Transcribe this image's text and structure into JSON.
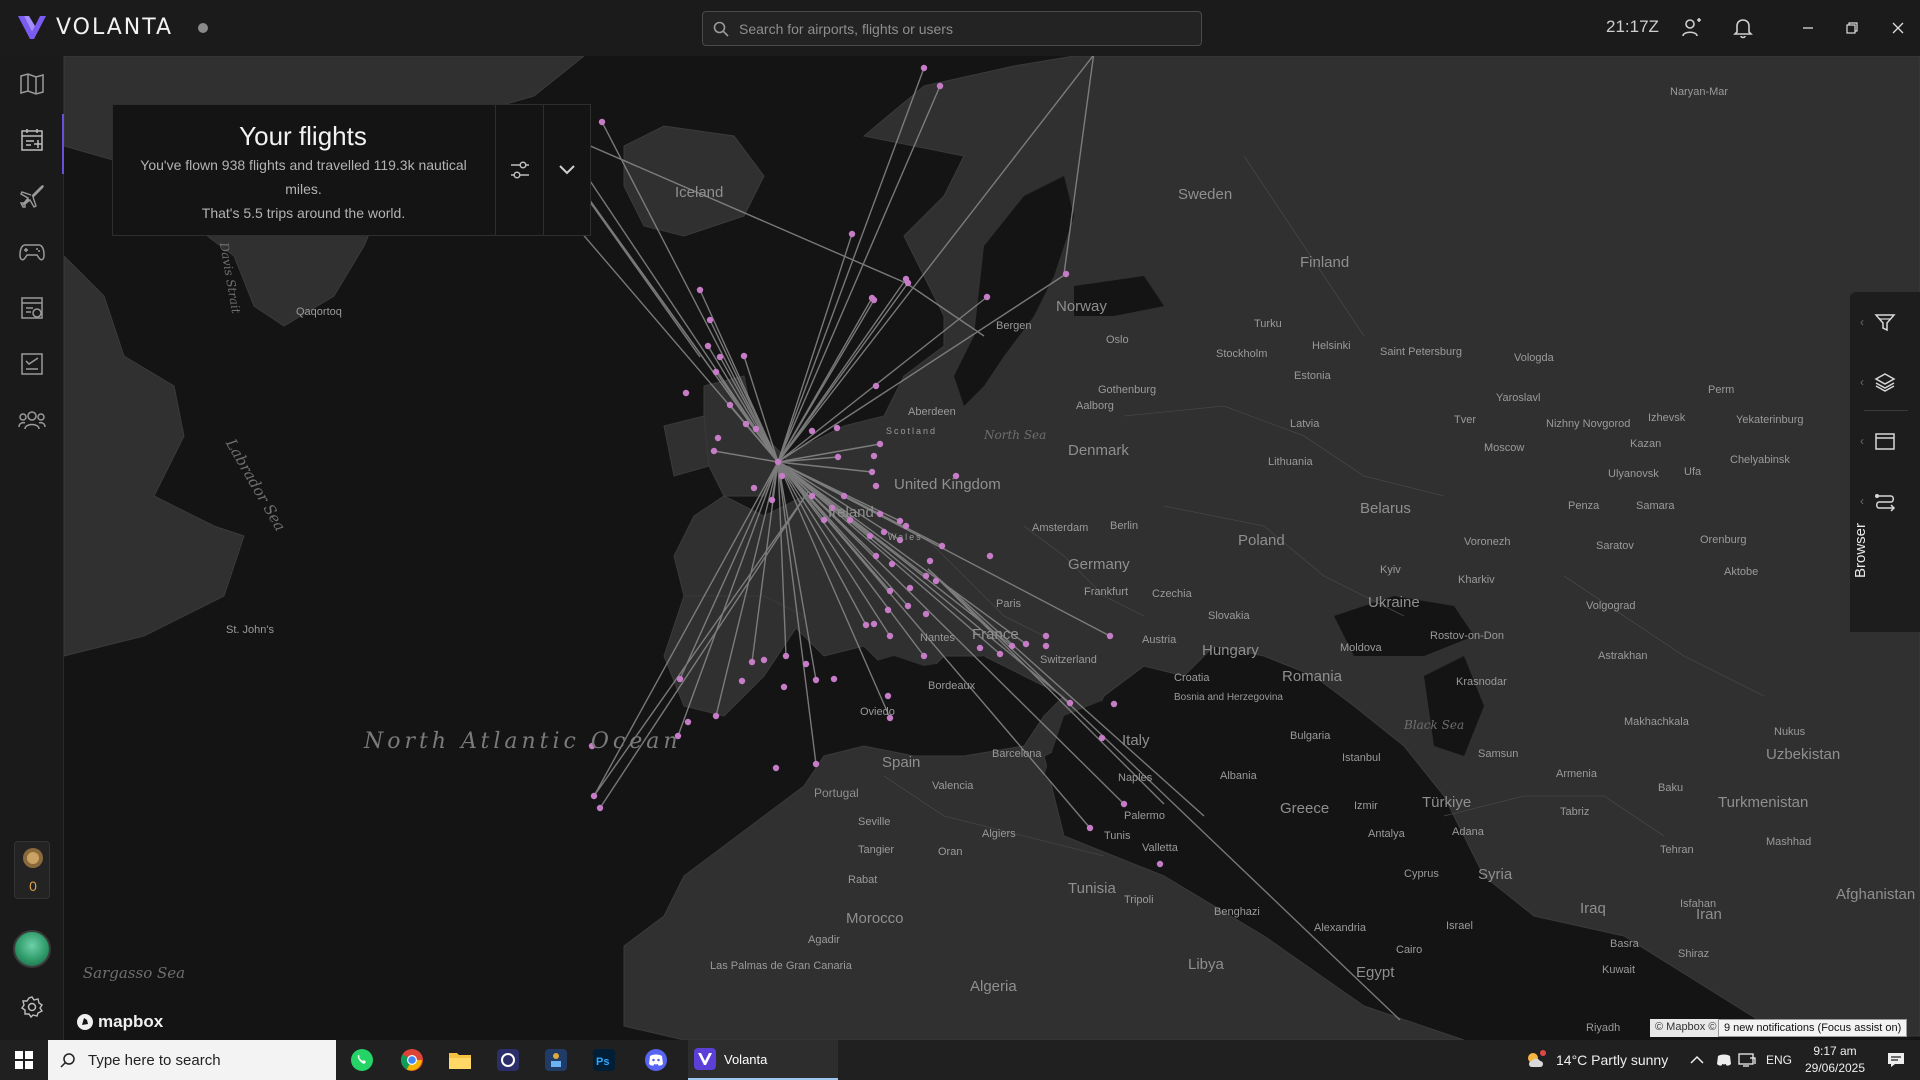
{
  "app": {
    "name": "VOLANTA",
    "zulu_time": "21:17Z",
    "search_placeholder": "Search for airports, flights or users"
  },
  "flights_panel": {
    "title": "Your flights",
    "summary_line1": "You've flown 938 flights and travelled 119.3k nautical miles.",
    "summary_line2": "That's 5.5 trips around the world."
  },
  "rail": {
    "items": [
      "map-icon",
      "logbook-icon",
      "aircraft-icon",
      "gamepad-icon",
      "reports-icon",
      "checklist-icon",
      "community-icon"
    ],
    "badge_count": "0",
    "settings": "gear-icon"
  },
  "right_tools": {
    "items": [
      "filter-icon",
      "layers-icon",
      "calendar-icon",
      "routes-icon"
    ],
    "browser_label": "Browser"
  },
  "map": {
    "logo": "mapbox",
    "attribution": "© Mapbox ©",
    "labels": {
      "oceans": [
        "North Atlantic Ocean",
        "Sargasso Sea"
      ],
      "seas": [
        "Labrador Sea",
        "North Sea",
        "Black Sea",
        "Davis Strait"
      ],
      "countries": [
        "Iceland",
        "Sweden",
        "Finland",
        "Norway",
        "Denmark",
        "United Kingdom",
        "Ireland",
        "Germany",
        "Poland",
        "Belarus",
        "Ukraine",
        "France",
        "Spain",
        "Portugal",
        "Italy",
        "Hungary",
        "Romania",
        "Greece",
        "Türkiye",
        "Syria",
        "Iraq",
        "Iran",
        "Egypt",
        "Libya",
        "Algeria",
        "Tunisia",
        "Morocco",
        "Uzbekistan",
        "Turkmenistan",
        "Afghanistan",
        "Estonia",
        "Latvia",
        "Lithuania",
        "Moldova",
        "Bulgaria",
        "Albania",
        "Croatia",
        "Bosnia and Herzegovina",
        "Slovakia",
        "Czechia",
        "Austria",
        "Switzerland",
        "Armenia",
        "Cyprus",
        "Israel",
        "Kuwait",
        "Wales",
        "Scotland"
      ],
      "cities": [
        "Oslo",
        "Stockholm",
        "Helsinki",
        "Bergen",
        "Gothenburg",
        "Aalborg",
        "Turku",
        "Saint Petersburg",
        "Vologda",
        "Yaroslavl",
        "Perm",
        "Yekaterinburg",
        "Izhevsk",
        "Chelyabinsk",
        "Nizhny Novgorod",
        "Moscow",
        "Kazan",
        "Ulyanovsk",
        "Ufa",
        "Samara",
        "Penza",
        "Voronezh",
        "Saratov",
        "Orenburg",
        "Aktobe",
        "Volgograd",
        "Kharkiv",
        "Kyiv",
        "Rostov-on-Don",
        "Krasnodar",
        "Astrakhan",
        "Makhachkala",
        "Nukus",
        "Baku",
        "Tabriz",
        "Tehran",
        "Mashhad",
        "Isfahan",
        "Shiraz",
        "Basra",
        "Riyadh",
        "Samsun",
        "Istanbul",
        "Izmir",
        "Antalya",
        "Adana",
        "Cairo",
        "Alexandria",
        "Benghazi",
        "Tripoli",
        "Tunis",
        "Valletta",
        "Palermo",
        "Naples",
        "Algiers",
        "Oran",
        "Rabat",
        "Agadir",
        "Tangier",
        "Seville",
        "Valencia",
        "Barcelona",
        "Bordeaux",
        "Nantes",
        "Paris",
        "Frankfurt",
        "Amsterdam",
        "Berlin",
        "Aberdeen",
        "Qaqortoq",
        "St. John's",
        "Oviedo",
        "Las Palmas de Gran Canaria",
        "Naryan-Mar",
        "Tver"
      ]
    }
  },
  "taskbar": {
    "search_placeholder": "Type here to search",
    "apps": [
      "whatsapp-icon",
      "chrome-icon",
      "file-explorer-icon",
      "obs-icon",
      "app-icon",
      "photoshop-icon",
      "discord-icon"
    ],
    "active_app": "Volanta",
    "weather": "14°C  Partly sunny",
    "language": "ENG",
    "time": "9:17 am",
    "date": "29/06/2025",
    "notification": "9 new notifications (Focus assist on)"
  }
}
